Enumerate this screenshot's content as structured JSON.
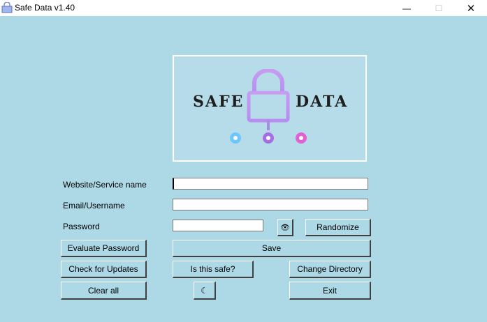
{
  "window": {
    "title": "Safe Data v1.40",
    "minimize_glyph": "—",
    "maximize_glyph": "☐",
    "close_glyph": "✕"
  },
  "logo": {
    "word_left": "SAFE",
    "word_right": "DATA",
    "icon": "padlock-network-icon",
    "colors": {
      "start": "#6ec6ff",
      "mid": "#a56ee6",
      "end": "#e25fd6"
    }
  },
  "form": {
    "website_label": "Website/Service name",
    "website_value": "",
    "username_label": "Email/Username",
    "username_value": "",
    "password_label": "Password",
    "password_value": ""
  },
  "buttons": {
    "show_password": "👁",
    "randomize": "Randomize",
    "evaluate": "Evaluate Password",
    "save": "Save",
    "check_updates": "Check for Updates",
    "is_safe": "Is this safe?",
    "change_directory": "Change Directory",
    "clear_all": "Clear all",
    "theme_toggle": "☾",
    "exit": "Exit"
  },
  "colors": {
    "background": "#add8e6",
    "field": "#ffffff"
  }
}
